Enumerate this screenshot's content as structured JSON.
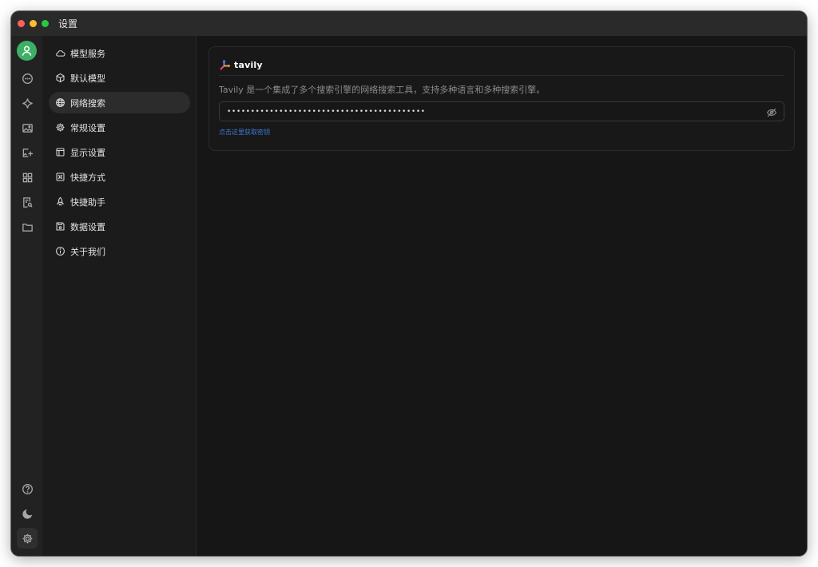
{
  "window": {
    "title": "设置",
    "traffic_lights": [
      "close",
      "minimize",
      "maximize"
    ]
  },
  "rail": {
    "top_items": [
      {
        "name": "avatar",
        "icon": "user-icon"
      },
      {
        "name": "chat",
        "icon": "chat-bubble-icon"
      },
      {
        "name": "assistants",
        "icon": "sparkle-icon"
      },
      {
        "name": "paintings",
        "icon": "image-icon"
      },
      {
        "name": "translate",
        "icon": "image-plus-icon"
      },
      {
        "name": "apps",
        "icon": "grid-icon"
      },
      {
        "name": "knowledge",
        "icon": "document-search-icon"
      },
      {
        "name": "files",
        "icon": "folder-icon"
      }
    ],
    "bottom_items": [
      {
        "name": "help",
        "icon": "question-circle-icon"
      },
      {
        "name": "theme",
        "icon": "moon-icon"
      },
      {
        "name": "settings",
        "icon": "gear-icon"
      }
    ]
  },
  "settings_nav": {
    "items": [
      {
        "label": "模型服务",
        "icon": "cloud-icon"
      },
      {
        "label": "默认模型",
        "icon": "cube-icon"
      },
      {
        "label": "网络搜索",
        "icon": "globe-icon"
      },
      {
        "label": "常规设置",
        "icon": "gear-icon"
      },
      {
        "label": "显示设置",
        "icon": "layout-icon"
      },
      {
        "label": "快捷方式",
        "icon": "command-icon"
      },
      {
        "label": "快捷助手",
        "icon": "rocket-icon"
      },
      {
        "label": "数据设置",
        "icon": "save-icon"
      },
      {
        "label": "关于我们",
        "icon": "info-icon"
      }
    ],
    "active_index": 2
  },
  "provider": {
    "name": "tavily",
    "description": "Tavily 是一个集成了多个搜索引擎的网络搜索工具，支持多种语言和多种搜索引擎。",
    "api_key_masked": "••••••••••••••••••••••••••••••••••••••••••",
    "toggle_icon": "eye-off-icon",
    "get_key_link": "点击这里获取密钥"
  },
  "colors": {
    "accent_green": "#3db066",
    "link_blue": "#3f7ad9",
    "background": "#161616"
  }
}
